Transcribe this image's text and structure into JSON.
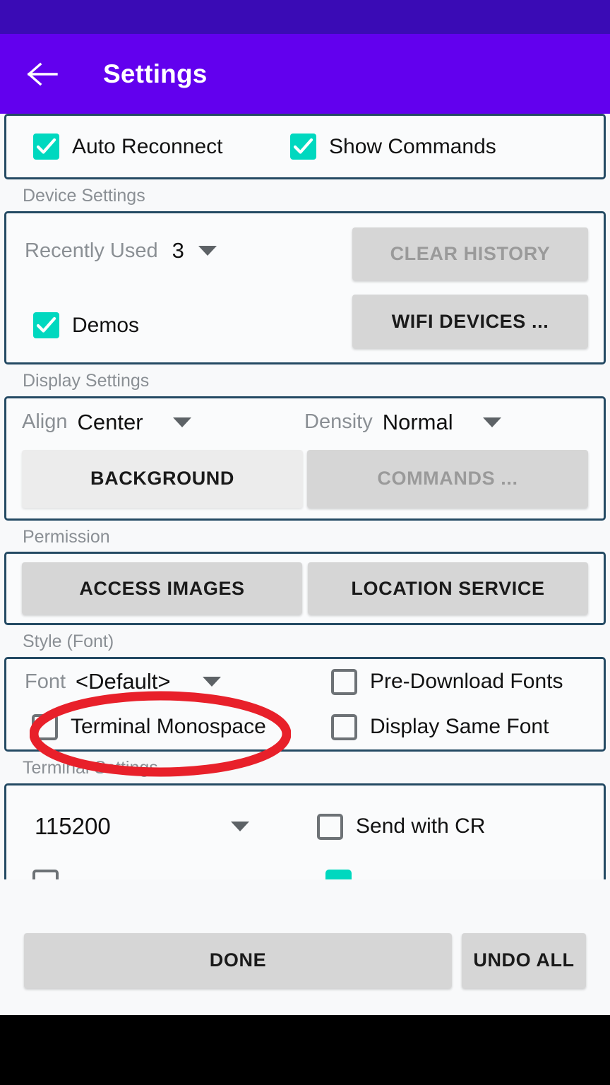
{
  "app": {
    "title": "Settings",
    "back_icon": "back-arrow-icon",
    "appbar_color": "#6200EE",
    "statusbar_color": "#3A0BB5",
    "accent_color": "#00D8BF",
    "panel_border_color": "#244A63",
    "page_background": "#F8F9FA"
  },
  "toggles": {
    "auto_reconnect": {
      "label": "Auto Reconnect",
      "checked": true
    },
    "show_commands": {
      "label": "Show Commands",
      "checked": true
    }
  },
  "device_settings": {
    "section_label": "Device Settings",
    "recently_used": {
      "label": "Recently Used",
      "value": "3",
      "caret_icon": "chevron-down-icon"
    },
    "demos": {
      "label": "Demos",
      "checked": true
    },
    "clear_history_button": {
      "label": "CLEAR HISTORY",
      "disabled": true
    },
    "wifi_devices_button": {
      "label": "WIFI DEVICES ...",
      "disabled": false
    }
  },
  "display_settings": {
    "section_label": "Display Settings",
    "align": {
      "label": "Align",
      "value": "Center",
      "caret_icon": "chevron-down-icon"
    },
    "density": {
      "label": "Density",
      "value": "Normal",
      "caret_icon": "chevron-down-icon"
    },
    "background_button": {
      "label": "BACKGROUND",
      "disabled": false
    },
    "commands_button": {
      "label": "COMMANDS ...",
      "disabled": true
    }
  },
  "permission": {
    "section_label": "Permission",
    "access_images_button": {
      "label": "ACCESS IMAGES",
      "disabled": false
    },
    "location_service_button": {
      "label": "LOCATION SERVICE",
      "disabled": false
    }
  },
  "style_font": {
    "section_label": "Style (Font)",
    "font": {
      "label": "Font",
      "value": "<Default>",
      "caret_icon": "chevron-down-icon"
    },
    "pre_download_fonts": {
      "label": "Pre-Download Fonts",
      "checked": false
    },
    "terminal_monospace": {
      "label": "Terminal Monospace",
      "checked": false
    },
    "display_same_font": {
      "label": "Display Same Font",
      "checked": false
    }
  },
  "terminal_settings": {
    "section_label": "Terminal Settings",
    "baud_rate": {
      "value": "115200",
      "caret_icon": "chevron-down-icon"
    },
    "send_with_cr": {
      "label": "Send with CR",
      "checked": false
    }
  },
  "bottom_bar": {
    "done_button": "DONE",
    "undo_all_button": "UNDO ALL"
  },
  "annotation": {
    "shape": "ellipse",
    "color": "#E8202A",
    "target": "ACCESS IMAGES"
  }
}
